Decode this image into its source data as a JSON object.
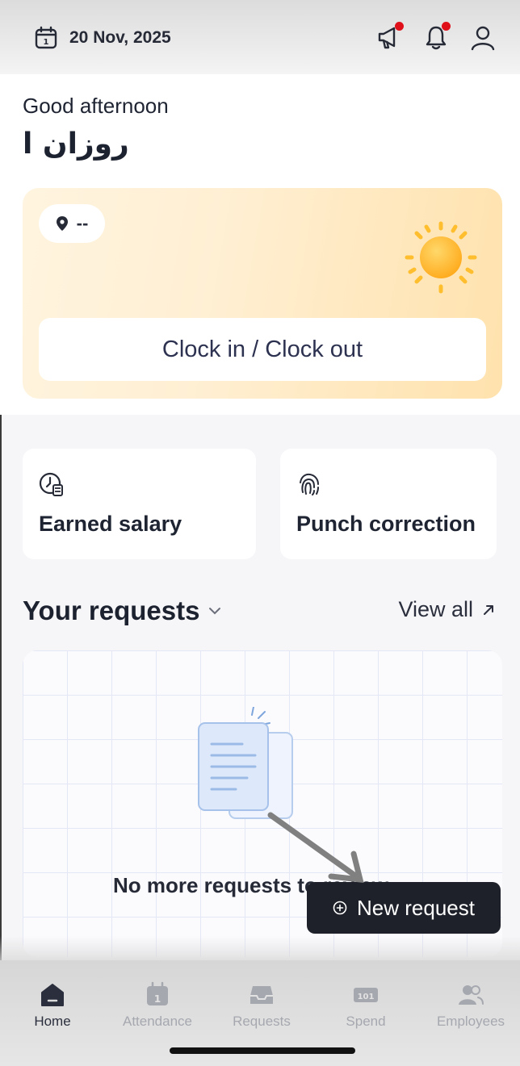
{
  "header": {
    "date": "20 Nov, 2025",
    "icons": [
      "calendar-icon",
      "megaphone-icon",
      "bell-icon",
      "user-icon"
    ],
    "notification_color": "#e0101a"
  },
  "greeting": {
    "text": "Good afternoon",
    "name": "روزان ا"
  },
  "clock": {
    "location": "--",
    "button_label": "Clock in / Clock out",
    "icons": [
      "location-pin-icon",
      "sun-icon"
    ]
  },
  "actions": [
    {
      "label": "Earned salary",
      "icon": "salary-clock-icon"
    },
    {
      "label": "Punch correction",
      "icon": "fingerprint-icon"
    }
  ],
  "requests": {
    "title": "Your requests",
    "view_all": "View all",
    "empty_text": "No more requests to review",
    "new_request": "New request"
  },
  "nav": [
    {
      "label": "Home",
      "icon": "home-icon",
      "active": true
    },
    {
      "label": "Attendance",
      "icon": "calendar-icon"
    },
    {
      "label": "Requests",
      "icon": "inbox-icon"
    },
    {
      "label": "Spend",
      "icon": "money-icon"
    },
    {
      "label": "Employees",
      "icon": "users-icon"
    }
  ],
  "colors": {
    "accent_dark": "#1e2129",
    "clock_card_gradient": [
      "#fff4df",
      "#ffe2ad"
    ],
    "sun": "#ffb21e"
  }
}
